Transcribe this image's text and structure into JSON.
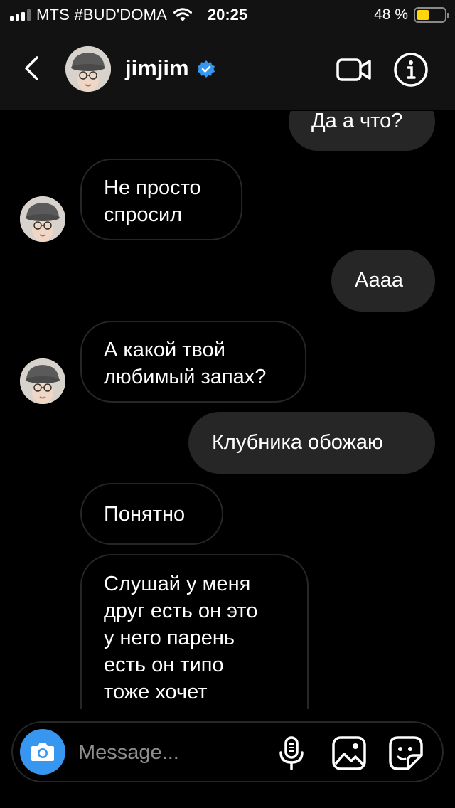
{
  "status_bar": {
    "carrier": "MTS #BUD'DOMA",
    "time": "20:25",
    "battery_percent": "48 %",
    "battery_level": 0.48,
    "icons": [
      "signal-icon",
      "wifi-icon",
      "battery-icon"
    ]
  },
  "header": {
    "username": "jimjim",
    "verified": true,
    "icons": [
      "back-icon",
      "avatar",
      "verified-badge-icon",
      "video-call-icon",
      "info-icon"
    ]
  },
  "messages": [
    {
      "direction": "outgoing",
      "text": "Да а что?"
    },
    {
      "direction": "incoming",
      "lines": [
        "Не просто",
        "спросил"
      ],
      "avatar": true
    },
    {
      "direction": "outgoing",
      "text": "Аааа"
    },
    {
      "direction": "incoming",
      "lines": [
        "А какой твой",
        "любимый запах?"
      ],
      "avatar": true
    },
    {
      "direction": "outgoing",
      "text": "Клубника обожаю"
    },
    {
      "direction": "incoming",
      "text": "Понятно"
    },
    {
      "direction": "incoming",
      "lines": [
        "Слушай у меня",
        "друг есть он это",
        "у него парень",
        "есть он типо",
        "тоже хочет"
      ]
    }
  ],
  "composer": {
    "placeholder": "Message...",
    "icons": [
      "camera-icon",
      "microphone-icon",
      "gallery-icon",
      "sticker-icon"
    ]
  },
  "colors": {
    "background": "#000000",
    "header_bg": "#121212",
    "outgoing_bubble": "#262626",
    "incoming_border": "#262626",
    "accent_blue": "#3797f0",
    "battery_yellow": "#ffd60a"
  }
}
